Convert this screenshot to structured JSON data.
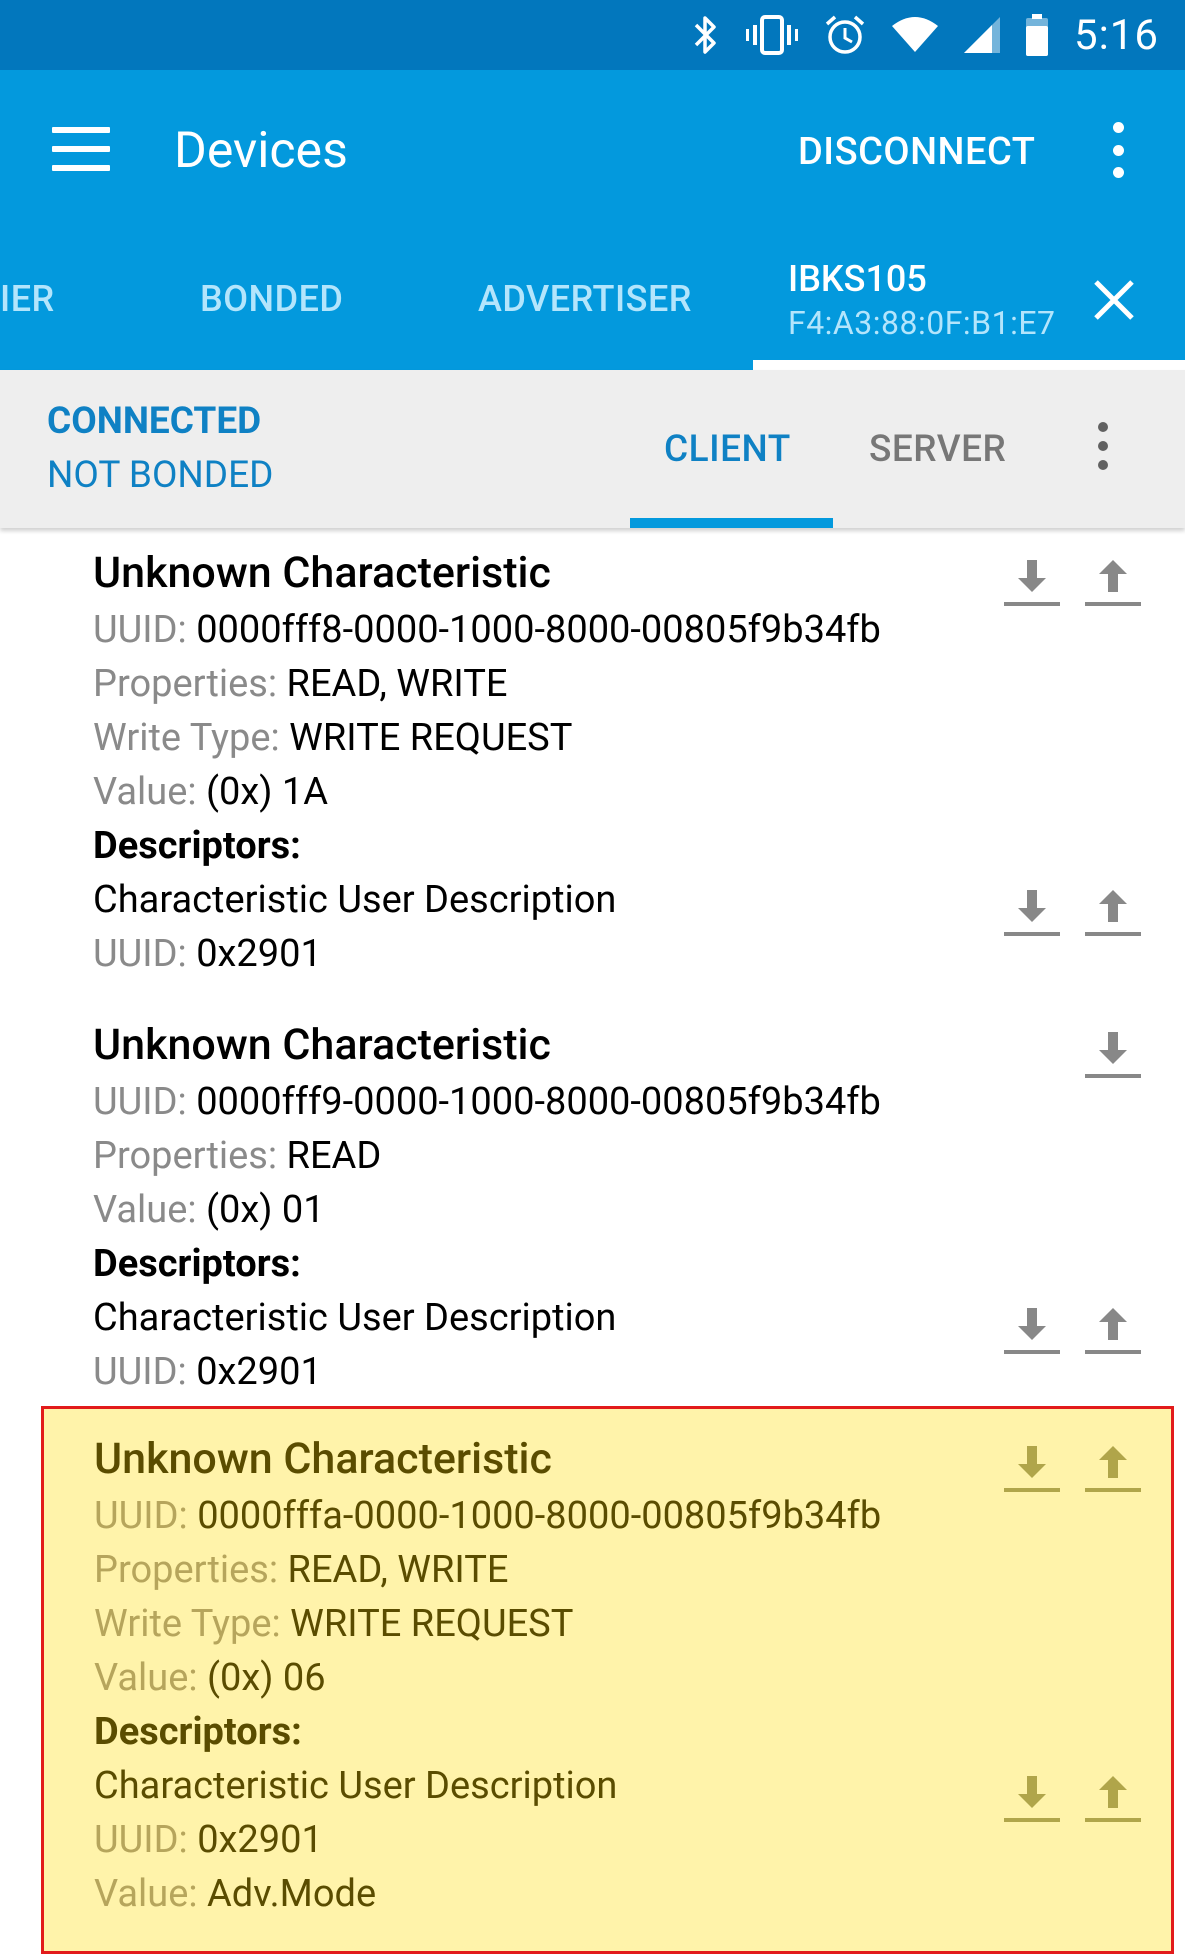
{
  "status_bar": {
    "time": "5:16",
    "icons": [
      "bluetooth-icon",
      "vibrate-icon",
      "alarm-icon",
      "wifi-icon",
      "cell-signal-icon",
      "battery-icon"
    ]
  },
  "app_bar": {
    "title": "Devices",
    "disconnect_label": "DISCONNECT"
  },
  "tabs": {
    "scanner": "IER",
    "bonded": "BONDED",
    "advertiser": "ADVERTISER",
    "device": {
      "name": "IBKS105",
      "address": "F4:A3:88:0F:B1:E7"
    }
  },
  "connection": {
    "state": "CONNECTED",
    "bond_state": "NOT BONDED",
    "tabs": {
      "client": "CLIENT",
      "server": "SERVER"
    }
  },
  "labels": {
    "uuid": "UUID:",
    "properties": "Properties:",
    "write_type": "Write Type:",
    "value": "Value:",
    "descriptors": "Descriptors:"
  },
  "characteristics": [
    {
      "title": "Unknown Characteristic",
      "uuid": "0000fff8-0000-1000-8000-00805f9b34fb",
      "properties": "READ, WRITE",
      "write_type": "WRITE REQUEST",
      "value": "(0x) 1A",
      "descriptor": {
        "name": "Characteristic User Description",
        "uuid": "0x2901"
      }
    },
    {
      "title": "Unknown Characteristic",
      "uuid": "0000fff9-0000-1000-8000-00805f9b34fb",
      "properties": "READ",
      "value": "(0x) 01",
      "descriptor": {
        "name": "Characteristic User Description",
        "uuid": "0x2901"
      }
    },
    {
      "title": "Unknown Characteristic",
      "uuid": "0000fffa-0000-1000-8000-00805f9b34fb",
      "properties": "READ, WRITE",
      "write_type": "WRITE REQUEST",
      "value": "(0x) 06",
      "descriptor": {
        "name": "Characteristic User Description",
        "uuid": "0x2901",
        "value": "Adv.Mode"
      }
    }
  ],
  "colors": {
    "status_bar": "#0277bd",
    "primary": "#0399dd",
    "accent_text": "#0f81c4",
    "highlight_bg": "#fff3aa",
    "highlight_border": "#e21b1b"
  }
}
